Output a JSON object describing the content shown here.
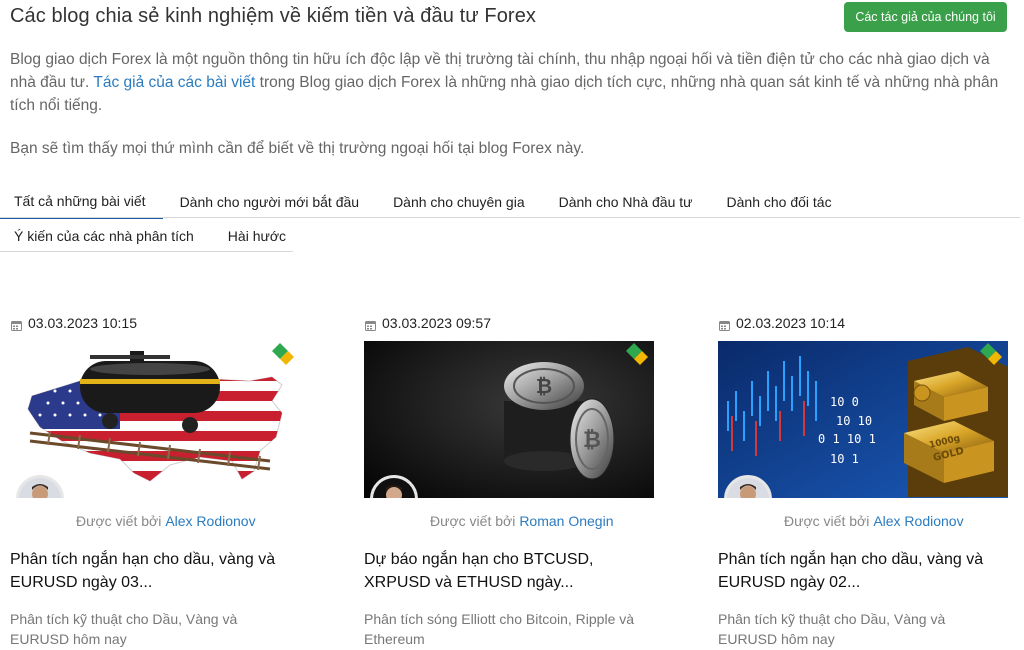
{
  "header": {
    "title": "Các blog chia sẻ kinh nghiệm về kiếm tiền và đầu tư Forex",
    "authors_button": "Các tác giả của chúng tôi"
  },
  "intro": {
    "text_before_link": "Blog giao dịch Forex là một nguồn thông tin hữu ích độc lập về thị trường tài chính, thu nhập ngoại hối và tiền điện tử cho các nhà giao dịch và nhà đầu tư. ",
    "link": "Tác giả của các bài viết",
    "text_after_link": " trong Blog giao dịch Forex là những nhà giao dịch tích cực, những nhà quan sát kinh tế và những nhà phân tích nổi tiếng.",
    "second_paragraph": "Bạn sẽ tìm thấy mọi thứ mình cần để biết về thị trường ngoại hối tại blog Forex này."
  },
  "tabs": [
    {
      "label": "Tất cả những bài viết",
      "active": true
    },
    {
      "label": "Dành cho người mới bắt đầu",
      "active": false
    },
    {
      "label": "Dành cho chuyên gia",
      "active": false
    },
    {
      "label": "Dành cho Nhà đầu tư",
      "active": false
    },
    {
      "label": "Dành cho đối tác",
      "active": false
    },
    {
      "label": "Ý kiến của các nhà phân tích",
      "active": false
    },
    {
      "label": "Hài hước",
      "active": false
    }
  ],
  "byline_prefix": "Được viết bởi",
  "posts": [
    {
      "date": "03.03.2023 10:15",
      "author": "Alex Rodionov",
      "title": "Phân tích ngắn hạn cho dầu, vàng và EURUSD ngày 03...",
      "description": "Phân tích kỹ thuật cho Dầu, Vàng và EURUSD hôm nay",
      "image": "oil-tank-usa-map"
    },
    {
      "date": "03.03.2023 09:57",
      "author": "Roman Onegin",
      "title": "Dự báo ngắn hạn cho BTCUSD, XRPUSD và ETHUSD ngày...",
      "description": "Phân tích sóng Elliott cho Bitcoin, Ripple và Ethereum",
      "image": "bitcoin-coins-dark"
    },
    {
      "date": "02.03.2023 10:14",
      "author": "Alex Rodionov",
      "title": "Phân tích ngắn hạn cho dầu, vàng và EURUSD ngày 02...",
      "description": "Phân tích kỹ thuật cho Dầu, Vàng và EURUSD hôm nay",
      "image": "gold-bars-chart"
    }
  ],
  "image_text": {
    "binary_rows": [
      "10 0",
      "10 10",
      "0 1 10 1",
      "10 1"
    ],
    "gold_bar_label": "GOLD",
    "gold_bar_weight": "1000g"
  },
  "colors": {
    "accent_green": "#3aa04a",
    "link_blue": "#2a7bc0",
    "active_tab": "#1d5da8"
  }
}
